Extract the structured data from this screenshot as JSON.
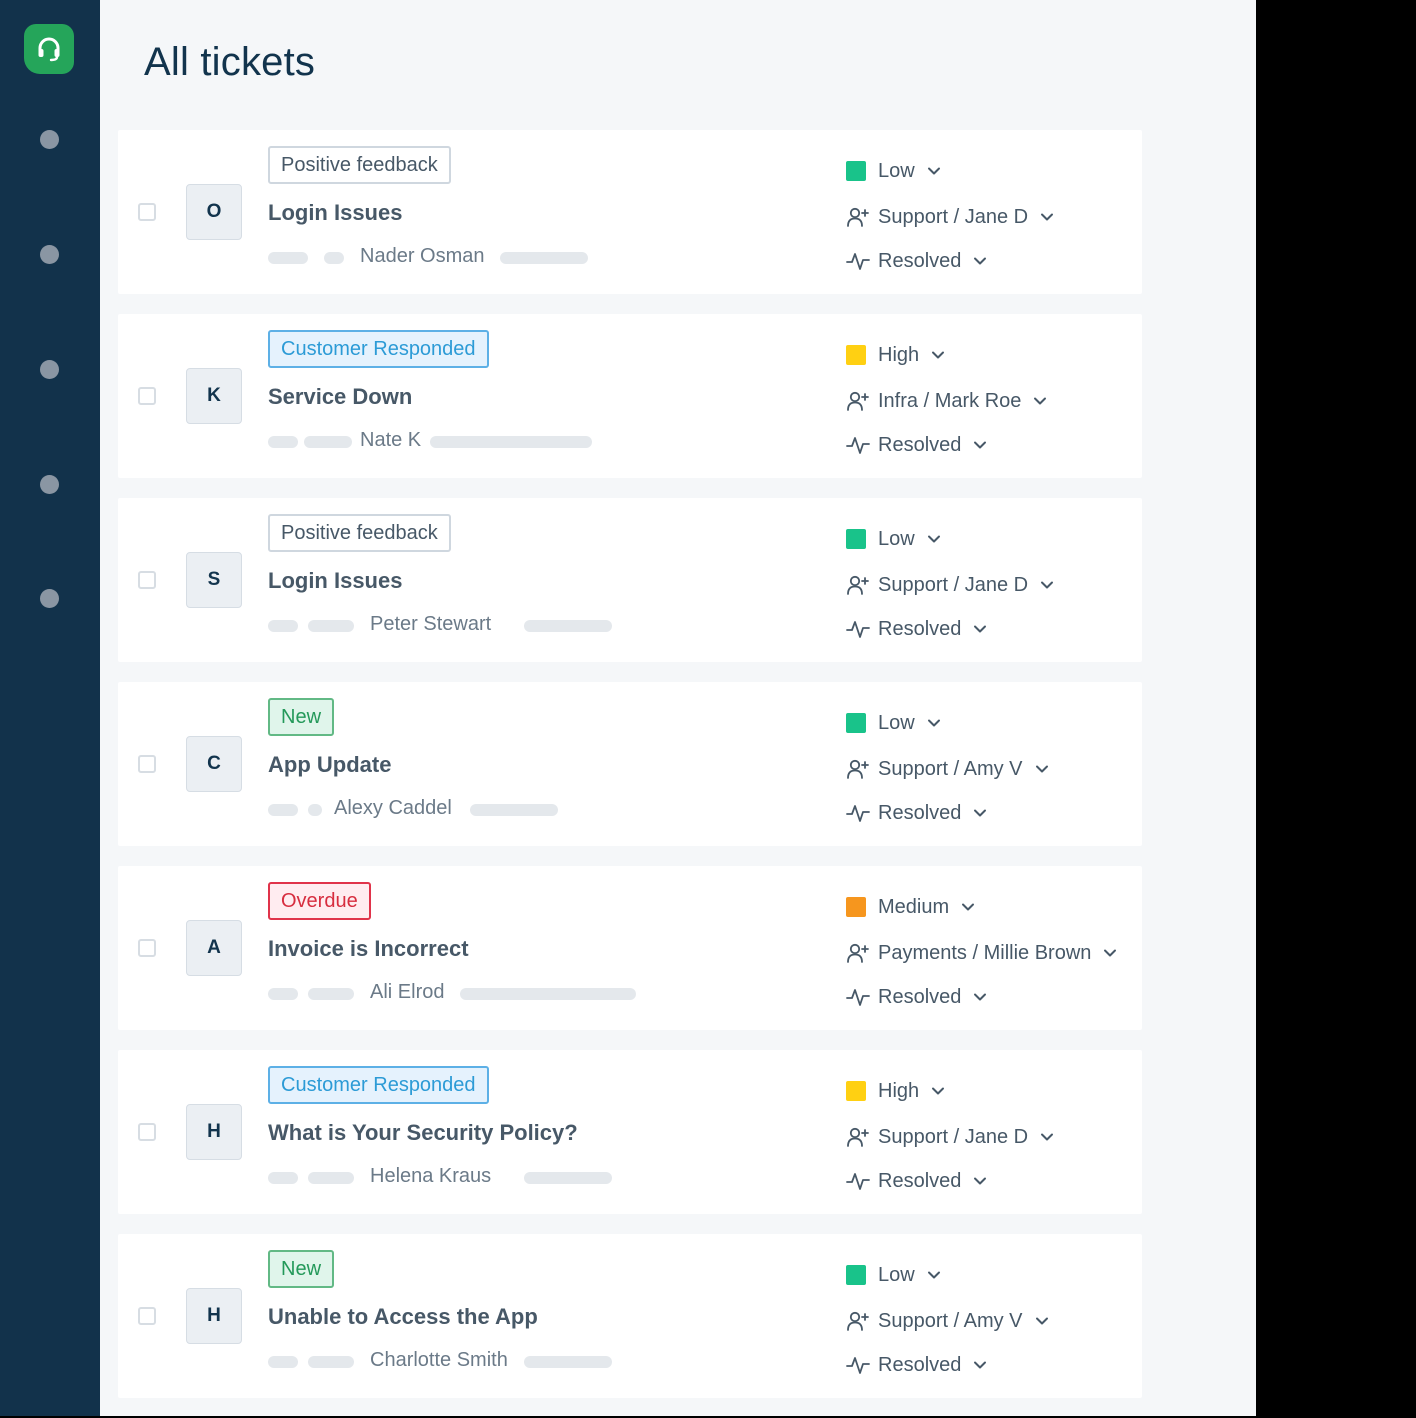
{
  "page": {
    "title": "All tickets"
  },
  "colors": {
    "sidebar": "#12324b",
    "logo": "#25a55a",
    "priority_low": "#19c38a",
    "priority_high": "#ffd012",
    "priority_medium": "#f6961e"
  },
  "sidebar": {
    "logo_icon": "headset-icon",
    "nav_items": 5
  },
  "tickets": [
    {
      "avatar": "O",
      "tag": "Positive feedback",
      "tag_tone": "neutral",
      "subject": "Login Issues",
      "requester": "Nader Osman",
      "priority": "Low",
      "priority_color": "#19c38a",
      "assignee": "Support / Jane D",
      "status": "Resolved"
    },
    {
      "avatar": "K",
      "tag": "Customer Responded",
      "tag_tone": "blue",
      "subject": "Service Down",
      "requester": "Nate K",
      "priority": "High",
      "priority_color": "#ffd012",
      "assignee": "Infra / Mark Roe",
      "status": "Resolved"
    },
    {
      "avatar": "S",
      "tag": "Positive feedback",
      "tag_tone": "neutral",
      "subject": "Login Issues",
      "requester": "Peter Stewart",
      "priority": "Low",
      "priority_color": "#19c38a",
      "assignee": "Support / Jane D",
      "status": "Resolved"
    },
    {
      "avatar": "C",
      "tag": "New",
      "tag_tone": "green",
      "subject": "App Update",
      "requester": "Alexy Caddel",
      "priority": "Low",
      "priority_color": "#19c38a",
      "assignee": "Support / Amy V",
      "status": "Resolved"
    },
    {
      "avatar": "A",
      "tag": "Overdue",
      "tag_tone": "red",
      "subject": "Invoice is Incorrect",
      "requester": "Ali Elrod",
      "priority": "Medium",
      "priority_color": "#f6961e",
      "assignee": "Payments / Millie Brown",
      "status": "Resolved"
    },
    {
      "avatar": "H",
      "tag": "Customer Responded",
      "tag_tone": "blue",
      "subject": "What is Your Security Policy?",
      "requester": "Helena Kraus",
      "priority": "High",
      "priority_color": "#ffd012",
      "assignee": "Support / Jane D",
      "status": "Resolved"
    },
    {
      "avatar": "H",
      "tag": "New",
      "tag_tone": "green",
      "subject": "Unable to Access the App",
      "requester": "Charlotte Smith",
      "priority": "Low",
      "priority_color": "#19c38a",
      "assignee": "Support / Amy V",
      "status": "Resolved"
    }
  ]
}
